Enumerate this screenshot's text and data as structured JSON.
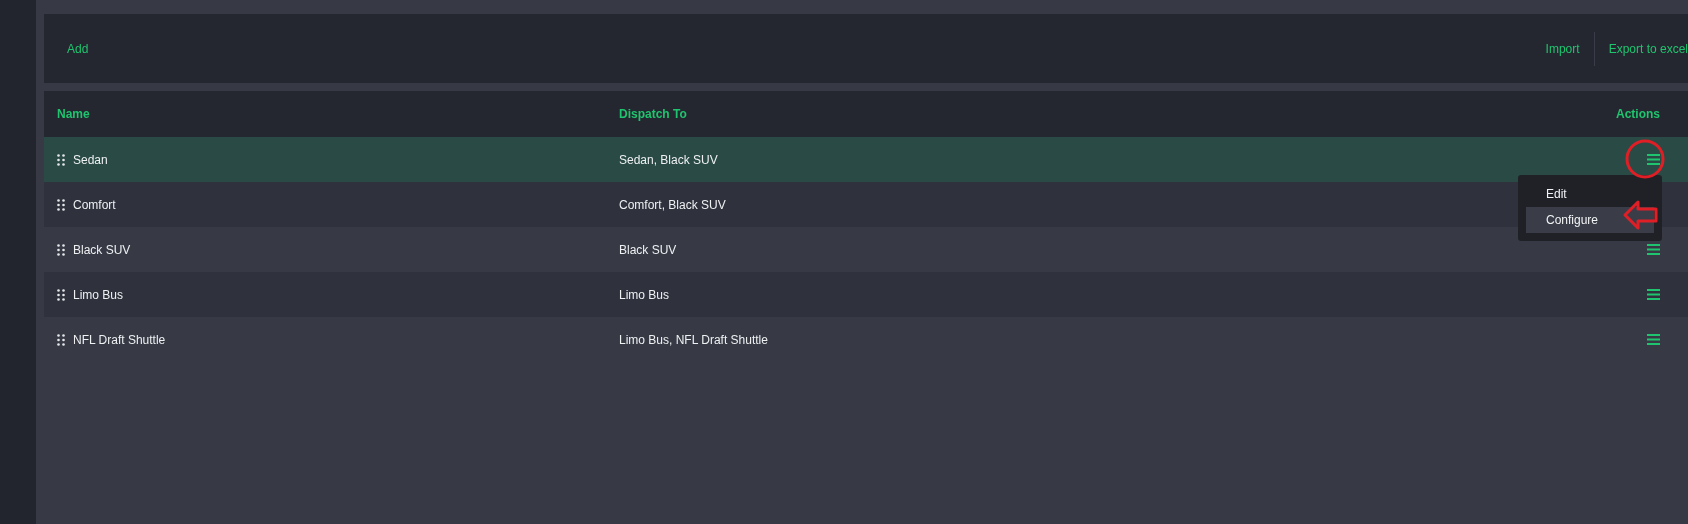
{
  "toolbar": {
    "left_actions": [
      "Add"
    ],
    "right_actions": [
      "Import",
      "Export to excel"
    ]
  },
  "table": {
    "columns": [
      "Name",
      "Dispatch To",
      "Actions"
    ],
    "rows": [
      {
        "name": "Sedan",
        "dispatch_to": "Sedan, Black SUV",
        "selected": true,
        "menu": [
          {
            "label": "Edit",
            "selected": false
          },
          {
            "label": "Configure",
            "selected": true
          }
        ]
      },
      {
        "name": "Comfort",
        "dispatch_to": "Comfort, Black SUV",
        "selected": false
      },
      {
        "name": "Black SUV",
        "dispatch_to": "Black SUV",
        "selected": false
      },
      {
        "name": "Limo Bus",
        "dispatch_to": "Limo Bus",
        "selected": false
      },
      {
        "name": "NFL Draft Shuttle",
        "dispatch_to": "Limo Bus, NFL Draft Shuttle",
        "selected": false
      }
    ]
  }
}
